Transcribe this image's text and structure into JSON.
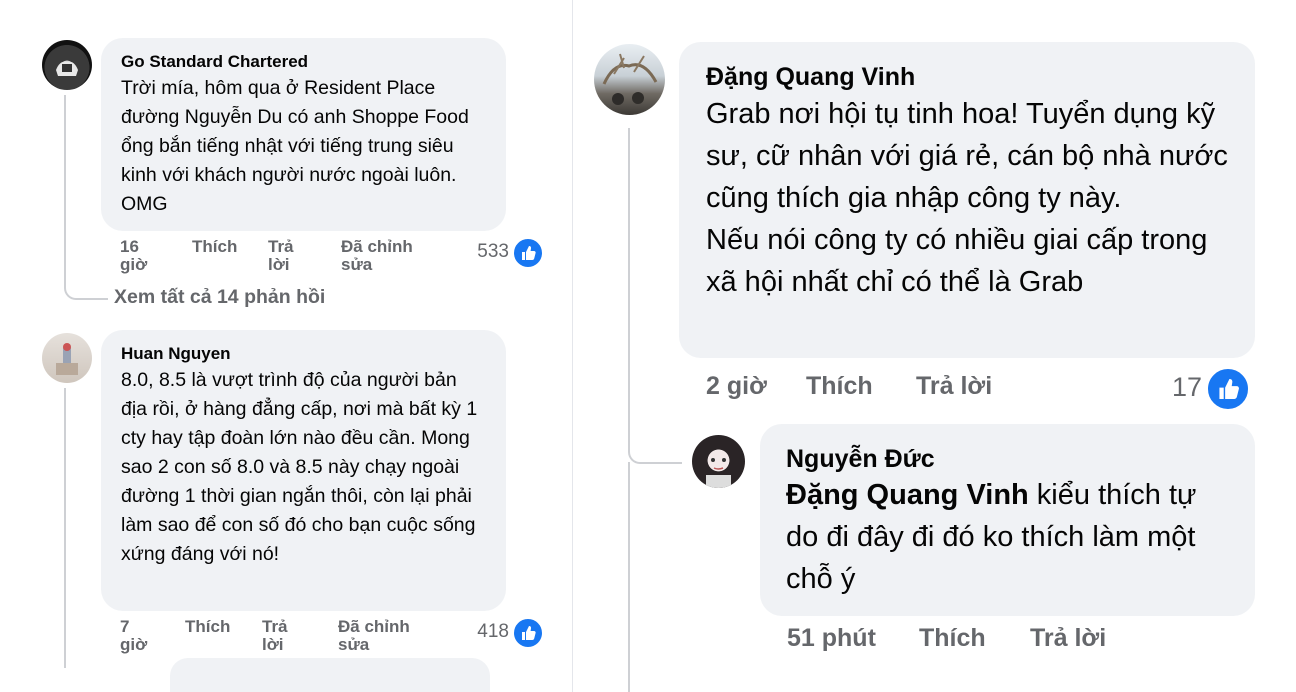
{
  "left": {
    "c1": {
      "author": "Go Standard Chartered",
      "text": "Trời mía, hôm qua ở Resident Place đường Nguyễn Du có anh Shoppe Food ổng bắn tiếng nhật với tiếng trung siêu kinh với khách người nước ngoài luôn. OMG",
      "time_a": "16",
      "time_b": "giờ",
      "like": "Thích",
      "reply_a": "Trả",
      "reply_b": "lời",
      "edited_a": "Đã chỉnh",
      "edited_b": "sửa",
      "likes": "533"
    },
    "view_replies": "Xem tất cả 14 phản hồi",
    "c2": {
      "author": "Huan Nguyen",
      "text": "8.0, 8.5 là vượt trình độ của người bản địa rồi, ở hàng đẳng cấp, nơi mà bất kỳ 1 cty hay tập đoàn lớn nào đều cần. Mong sao 2 con số 8.0 và 8.5 này chạy ngoài đường 1 thời gian ngắn thôi, còn lại phải làm sao để con số đó cho bạn cuộc sống xứng đáng với nó!",
      "time_a": "7",
      "time_b": "giờ",
      "like": "Thích",
      "reply_a": "Trả",
      "reply_b": "lời",
      "edited_a": "Đã chỉnh",
      "edited_b": "sửa",
      "likes": "418"
    }
  },
  "right": {
    "c1": {
      "author": "Đặng Quang Vinh",
      "line1": "Grab nơi hội tụ tinh hoa! Tuyển dụng kỹ sư, cữ nhân với giá rẻ, cán bộ nhà nước cũng thích gia nhập công ty này.",
      "line2": "Nếu nói công ty có nhiều giai cấp trong xã hội nhất chỉ có thể là Grab",
      "time": "2 giờ",
      "like": "Thích",
      "reply": "Trả lời",
      "likes": "17"
    },
    "c2": {
      "author": "Nguyễn Đức",
      "mention": "Đặng Quang Vinh",
      "text": " kiểu thích tự do đi đây đi đó ko thích làm một chỗ ý",
      "time": "51 phút",
      "like": "Thích",
      "reply": "Trả lời"
    }
  },
  "colors": {
    "bubble": "#f0f2f5",
    "meta_text": "#65676b",
    "like_blue": "#1877f2",
    "thread_line": "#ced0d4"
  },
  "icons": {
    "like_badge": "thumbs-up-icon"
  }
}
